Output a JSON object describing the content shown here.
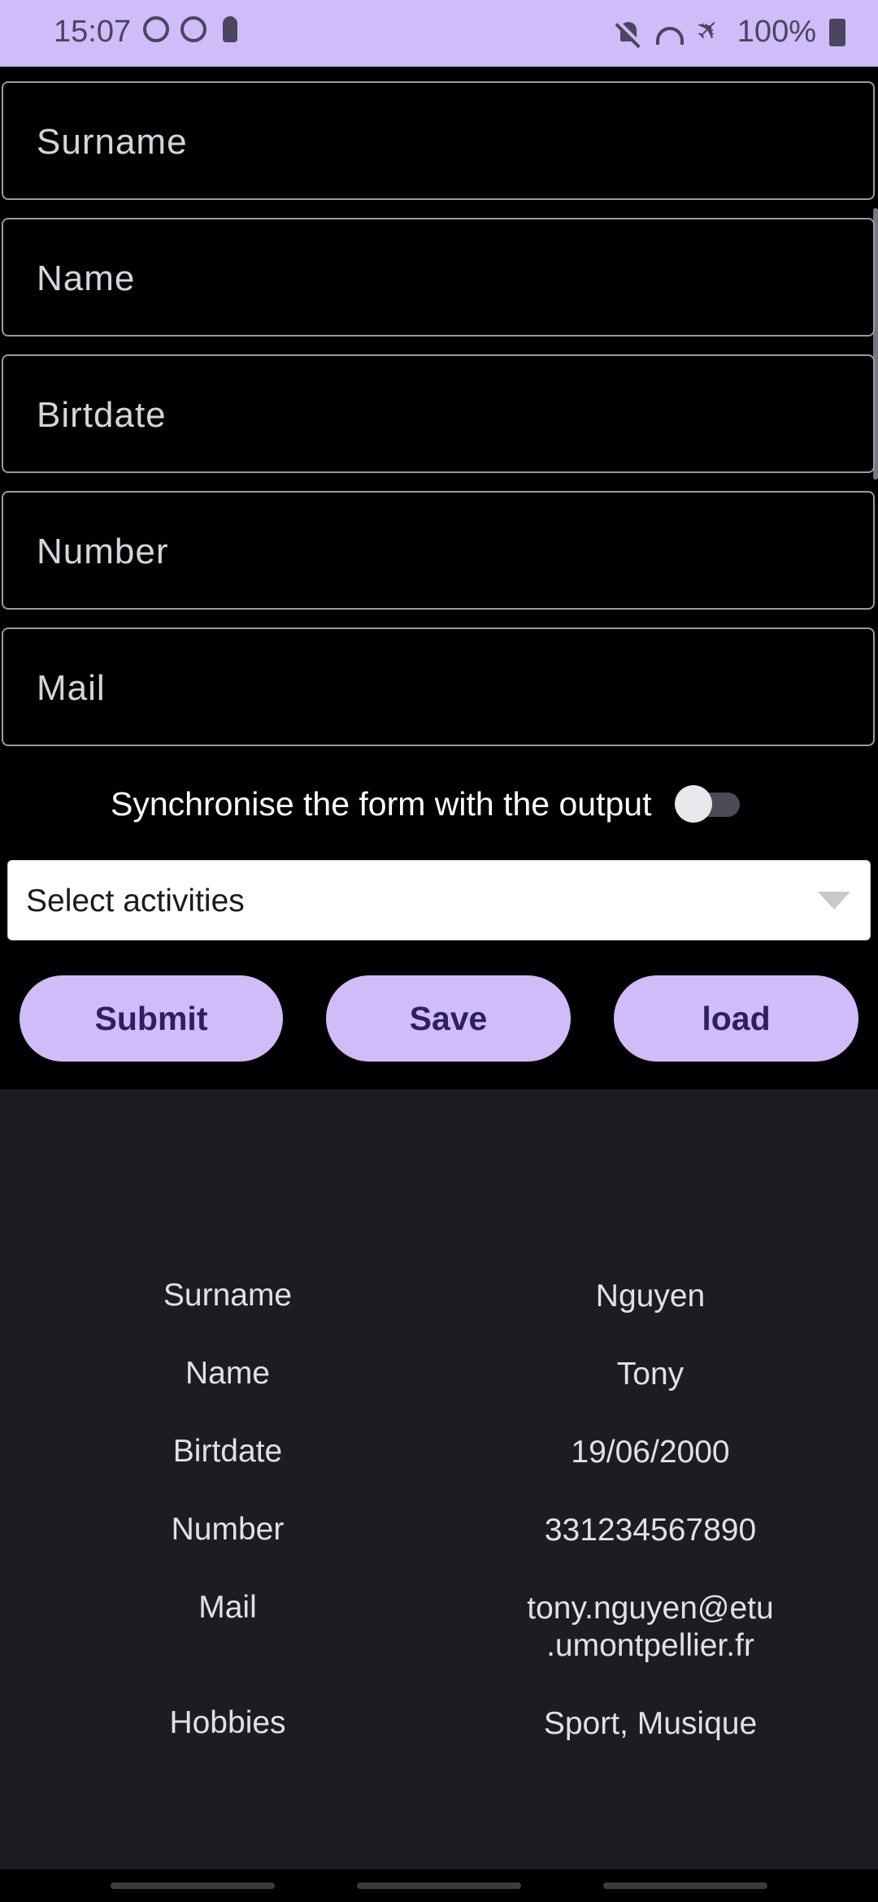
{
  "status_bar": {
    "time": "15:07",
    "battery": "100%",
    "icons": [
      "sync-icon",
      "heart-sync-icon",
      "key-icon",
      "mute-icon",
      "wifi-icon",
      "airplane-icon",
      "battery-icon"
    ]
  },
  "form": {
    "fields": [
      {
        "placeholder": "Surname"
      },
      {
        "placeholder": "Name"
      },
      {
        "placeholder": "Birtdate"
      },
      {
        "placeholder": "Number"
      },
      {
        "placeholder": "Mail"
      }
    ],
    "sync_label": "Synchronise the form with the output",
    "sync_enabled": false,
    "activities_placeholder": "Select activities"
  },
  "buttons": {
    "submit": "Submit",
    "save": "Save",
    "load": "load"
  },
  "output": {
    "rows": [
      {
        "key": "Surname",
        "value": "Nguyen"
      },
      {
        "key": "Name",
        "value": "Tony"
      },
      {
        "key": "Birtdate",
        "value": "19/06/2000"
      },
      {
        "key": "Number",
        "value": "331234567890"
      },
      {
        "key": "Mail",
        "value": "tony.nguyen@etu\n.umontpellier.fr"
      },
      {
        "key": "Hobbies",
        "value": "Sport, Musique"
      }
    ]
  },
  "colors": {
    "accent": "#cfbcf8",
    "button_text": "#2e1f60",
    "output_bg": "#1d1c21",
    "background": "#000000"
  }
}
